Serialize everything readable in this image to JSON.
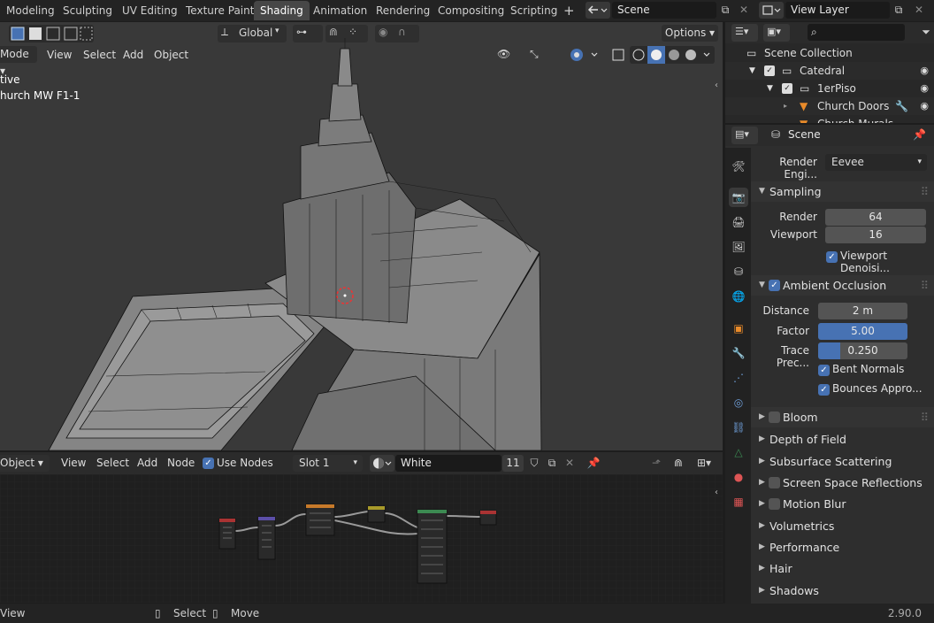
{
  "topbar": {
    "tabs": [
      "Modeling",
      "Sculpting",
      "UV Editing",
      "Texture Paint",
      "Shading",
      "Animation",
      "Rendering",
      "Compositing",
      "Scripting"
    ],
    "active_tab": "Shading",
    "add_tab": "+",
    "scene_name": "Scene",
    "view_layer": "View Layer"
  },
  "viewport": {
    "mode": "Mode",
    "menus": [
      "View",
      "Select",
      "Add",
      "Object"
    ],
    "orientation": "Global",
    "options": "Options",
    "overlay_line1": "tive",
    "overlay_line2": "hurch MW F1-1"
  },
  "node_editor": {
    "object_menu": "Object",
    "menus": [
      "View",
      "Select",
      "Add",
      "Node"
    ],
    "use_nodes": "Use Nodes",
    "slot": "Slot 1",
    "material": "White",
    "users": "11"
  },
  "outliner": {
    "search_placeholder": "",
    "items": [
      {
        "label": "Scene Collection"
      },
      {
        "label": "Catedral"
      },
      {
        "label": "1erPiso"
      },
      {
        "label": "Church Doors"
      },
      {
        "label": "Church Murals"
      }
    ]
  },
  "properties": {
    "context": "Scene",
    "render_engine_label": "Render Engi...",
    "render_engine": "Eevee",
    "sampling": {
      "title": "Sampling",
      "render_label": "Render",
      "render": "64",
      "viewport_label": "Viewport",
      "viewport": "16",
      "denoise": "Viewport Denoisi..."
    },
    "ao": {
      "title": "Ambient Occlusion",
      "distance_label": "Distance",
      "distance": "2 m",
      "factor_label": "Factor",
      "factor": "5.00",
      "trace_label": "Trace Prec...",
      "trace": "0.250",
      "bent_normals": "Bent Normals",
      "bounces": "Bounces Appro..."
    },
    "panels": [
      {
        "label": "Bloom",
        "checkbox": true
      },
      {
        "label": "Depth of Field",
        "checkbox": false
      },
      {
        "label": "Subsurface Scattering",
        "checkbox": false
      },
      {
        "label": "Screen Space Reflections",
        "checkbox": true
      },
      {
        "label": "Motion Blur",
        "checkbox": true
      },
      {
        "label": "Volumetrics",
        "checkbox": false
      },
      {
        "label": "Performance",
        "checkbox": false
      },
      {
        "label": "Hair",
        "checkbox": false
      },
      {
        "label": "Shadows",
        "checkbox": false
      }
    ]
  },
  "statusbar": {
    "left": "View",
    "select": "Select",
    "move": "Move",
    "version": "2.90.0"
  },
  "colors": {
    "accent": "#4772b3",
    "active_tab": "#474747",
    "object_orange": "#e98b2a"
  }
}
